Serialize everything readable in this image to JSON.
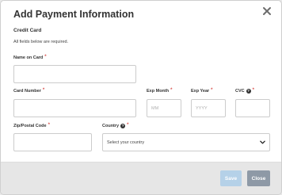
{
  "modal": {
    "title": "Add Payment Information",
    "close_icon": "close-icon"
  },
  "section": {
    "title": "Credit Card",
    "note": "All fields below are required."
  },
  "fields": {
    "name_on_card": {
      "label": "Name on Card",
      "value": "",
      "placeholder": ""
    },
    "card_number": {
      "label": "Card Number",
      "value": "",
      "placeholder": ""
    },
    "exp_month": {
      "label": "Exp Month",
      "value": "",
      "placeholder": "MM"
    },
    "exp_year": {
      "label": "Exp Year",
      "value": "",
      "placeholder": "YYYY"
    },
    "cvc": {
      "label": "CVC",
      "value": "",
      "placeholder": "",
      "help_icon": "question-circle-icon"
    },
    "zip": {
      "label": "Zip/Postal Code",
      "value": "",
      "placeholder": ""
    },
    "country": {
      "label": "Country",
      "selected": "Select your country",
      "help_icon": "question-circle-icon"
    }
  },
  "required_marker": "*",
  "help_glyph": "?",
  "buttons": {
    "save": "Save",
    "close": "Close"
  },
  "colors": {
    "required": "#d9534f",
    "save_button": "#b5d1e8",
    "close_button": "#8e99a6",
    "footer_bg": "#e6e6e6"
  }
}
